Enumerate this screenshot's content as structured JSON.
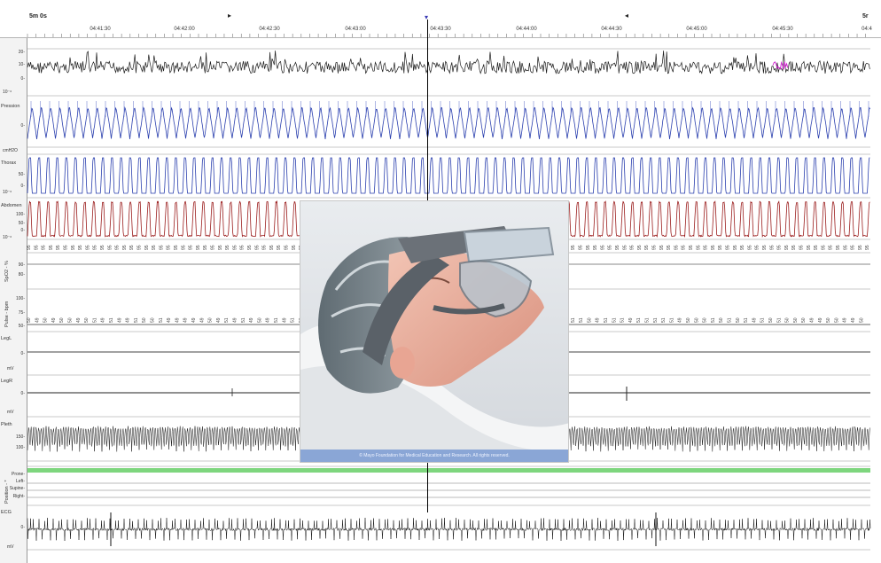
{
  "header": {
    "epoch_label": "5m 0s",
    "epoch_label_right": "5r",
    "time_labels": [
      "04:41:30",
      "04:42:00",
      "04:42:30",
      "04:43:00",
      "04:43:30",
      "04:44:00",
      "04:44:30",
      "04:45:00",
      "04:45:30",
      "04:4"
    ],
    "markers": {
      "right_arrow": "▸",
      "down_arrow": "▾",
      "left_arrow": "◂"
    }
  },
  "channels": [
    {
      "id": "snore",
      "label": "",
      "ticks": [
        "20-",
        "10-",
        "0-",
        "10⁻⁶"
      ],
      "color": "#1a1a1a"
    },
    {
      "id": "pression",
      "label": "Pression",
      "ticks": [
        "0-",
        "cmH2O"
      ],
      "color": "#2a3fae"
    },
    {
      "id": "thorax",
      "label": "Thorax",
      "ticks": [
        "50-",
        "0-",
        "10⁻⁶"
      ],
      "color": "#2a3fae"
    },
    {
      "id": "abdomen",
      "label": "Abdomen",
      "ticks": [
        "100-",
        "50-",
        "0-",
        "10⁻⁶"
      ],
      "color": "#9b1d1d"
    },
    {
      "id": "spo2",
      "label": "SpO2 - %",
      "ticks": [
        "90-",
        "80-"
      ],
      "color": "#555555"
    },
    {
      "id": "pulse",
      "label": "Pulse - bpm",
      "ticks": [
        "100-",
        "75-",
        "50-"
      ],
      "color": "#555555"
    },
    {
      "id": "legl",
      "label": "LegL",
      "ticks": [
        "0-",
        "mV"
      ],
      "color": "#1a1a1a"
    },
    {
      "id": "legr",
      "label": "LegR",
      "ticks": [
        "0-",
        "mV"
      ],
      "color": "#1a1a1a"
    },
    {
      "id": "pleth",
      "label": "Pleth",
      "ticks": [
        "150-",
        "100-"
      ],
      "color": "#1a1a1a"
    },
    {
      "id": "position",
      "label": "Position - *",
      "ticks": [
        "Prone-",
        "Left-",
        "Supine-",
        "Right-"
      ],
      "color": "#7ed67e"
    },
    {
      "id": "ecg",
      "label": "ECG",
      "ticks": [
        "0-",
        "mV"
      ],
      "color": "#1a1a1a"
    }
  ],
  "spo2_value_label": "95",
  "pulse_value_labels": [
    "50",
    "51",
    "49"
  ],
  "overlay": {
    "icon": "cpap-patient-illustration",
    "caption": "© Mayo Foundation for Medical Education and Research. All rights reserved."
  },
  "colors": {
    "snore": "#1a1a1a",
    "pression": "#2a3fae",
    "thorax": "#2a3fae",
    "abdomen": "#9b1d1d",
    "position": "#7ed67e",
    "magenta": "#d01fd0"
  }
}
